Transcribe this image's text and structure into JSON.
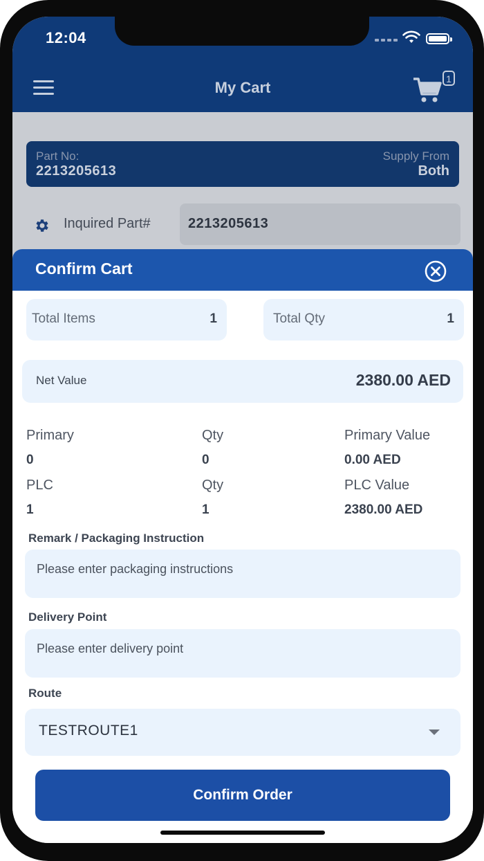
{
  "status_bar": {
    "time": "12:04"
  },
  "app_bar": {
    "title": "My Cart",
    "cart_count": "1"
  },
  "part_card": {
    "part_label": "Part No:",
    "part_value": "2213205613",
    "supply_label": "Supply From",
    "supply_value": "Both"
  },
  "inquired": {
    "label": "Inquired Part#",
    "value": "2213205613"
  },
  "confirm_cart": {
    "title": "Confirm Cart",
    "total_items_label": "Total Items",
    "total_items_value": "1",
    "total_qty_label": "Total Qty",
    "total_qty_value": "1",
    "net_value_label": "Net Value",
    "net_value": "2380.00 AED",
    "breakdown": {
      "primary_label": "Primary",
      "primary_qty_label": "Qty",
      "primary_value_label": "Primary Value",
      "primary_count": "0",
      "primary_qty": "0",
      "primary_value": "0.00 AED",
      "plc_label": "PLC",
      "plc_qty_label": "Qty",
      "plc_value_label": "PLC Value",
      "plc_count": "1",
      "plc_qty": "1",
      "plc_value": "2380.00 AED"
    },
    "remark_label": "Remark / Packaging Instruction",
    "remark_placeholder": "Please enter packaging instructions",
    "delivery_label": "Delivery Point",
    "delivery_placeholder": "Please enter delivery point",
    "route_label": "Route",
    "route_value": "TESTROUTE1",
    "confirm_button": "Confirm Order"
  },
  "colors": {
    "header": "#0f3a78",
    "sheet_header": "#1c56ad",
    "button": "#1c4fa6",
    "field_bg": "#eaf3fd"
  },
  "icons": [
    "menu-icon",
    "cart-icon",
    "gear-icon",
    "close-icon",
    "chevron-down-icon",
    "wifi-icon",
    "battery-icon"
  ]
}
